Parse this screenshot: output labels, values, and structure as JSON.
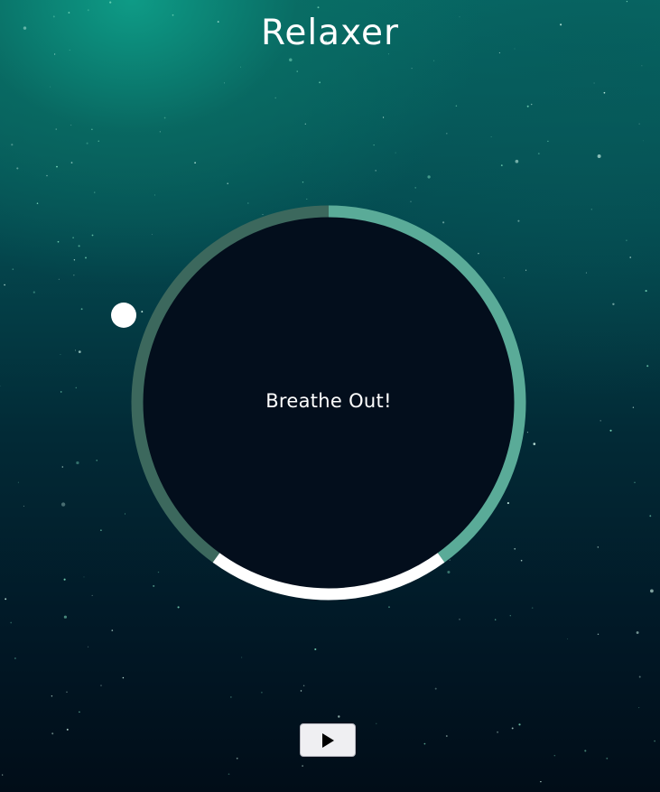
{
  "app": {
    "title": "Relaxer"
  },
  "breather": {
    "status_text": "Breathe Out!",
    "segments": [
      {
        "phase": "breathe-in",
        "color": "#5aab98",
        "fraction": 0.4
      },
      {
        "phase": "hold",
        "color": "#ffffff",
        "fraction": 0.2
      },
      {
        "phase": "breathe-out",
        "color": "#3c685d",
        "fraction": 0.4
      }
    ],
    "inner_color": "#030e1c",
    "pointer_color": "#ffffff"
  },
  "controls": {
    "play_icon": "play-icon"
  },
  "colors": {
    "title_text": "#ffffff",
    "button_bg": "#efeff2"
  }
}
